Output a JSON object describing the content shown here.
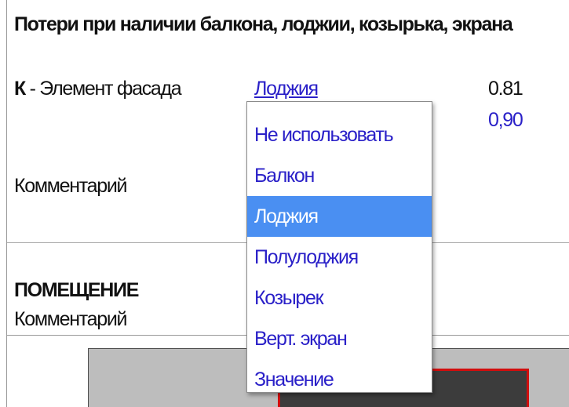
{
  "section": {
    "title": "Потери при наличии балкона, лоджии, козырька, экрана"
  },
  "parameter": {
    "key": "К",
    "separator": " - ",
    "label": "Элемент фасада",
    "selected_value": "Лоджия",
    "coefficient": "0.81",
    "coefficient_alt": "0,90",
    "comment_label": "Комментарий"
  },
  "room": {
    "title": "ПОМЕЩЕНИЕ",
    "comment_label": "Комментарий"
  },
  "dropdown": {
    "options": [
      "Не использовать",
      "Балкон",
      "Лоджия",
      "Полулоджия",
      "Козырек",
      "Верт. экран",
      "Значение"
    ],
    "highlighted_index": 2
  },
  "colors": {
    "link": "#2a20c8",
    "highlight": "#4a8ff2",
    "graphic_border": "#d10e0e"
  }
}
